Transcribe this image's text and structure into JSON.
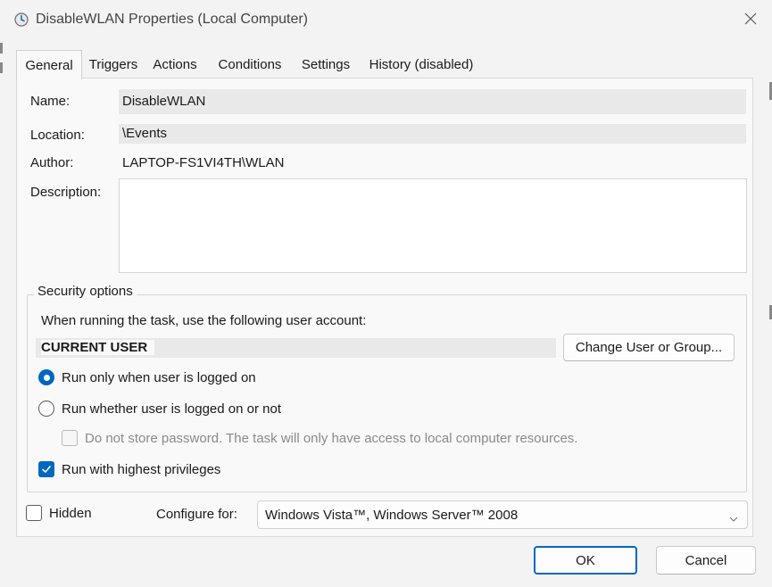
{
  "window": {
    "title": "DisableWLAN Properties (Local Computer)"
  },
  "tabs": [
    {
      "label": "General"
    },
    {
      "label": "Triggers"
    },
    {
      "label": "Actions"
    },
    {
      "label": "Conditions"
    },
    {
      "label": "Settings"
    },
    {
      "label": "History (disabled)"
    }
  ],
  "general": {
    "name_label": "Name:",
    "name_value": "DisableWLAN",
    "location_label": "Location:",
    "location_value": "\\Events",
    "author_label": "Author:",
    "author_value": "LAPTOP-FS1VI4TH\\WLAN",
    "description_label": "Description:",
    "description_value": ""
  },
  "security": {
    "legend": "Security options",
    "account_prompt": "When running the task, use the following user account:",
    "account_value": "CURRENT USER",
    "change_button": "Change User or Group...",
    "radio_logged_on": "Run only when user is logged on",
    "radio_logged_on_or_not": "Run whether user is logged on or not",
    "no_store_password": "Do not store password.  The task will only have access to local computer resources.",
    "highest_privileges": "Run with highest privileges"
  },
  "bottom": {
    "hidden_label": "Hidden",
    "configure_label": "Configure for:",
    "configure_value": "Windows Vista™, Windows Server™ 2008"
  },
  "buttons": {
    "ok": "OK",
    "cancel": "Cancel"
  },
  "colors": {
    "accent": "#0067c0",
    "window_bg": "#f3f3f3",
    "panel_bg": "#f9f9f9"
  },
  "state": {
    "selected_tab": "General",
    "run_mode": "logged_on_only",
    "no_store_password_checked": false,
    "no_store_password_enabled": false,
    "highest_privileges_checked": true,
    "hidden_checked": false
  }
}
